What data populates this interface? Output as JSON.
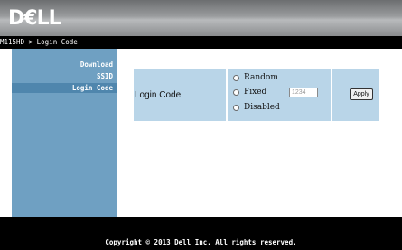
{
  "header": {
    "logo_text": "D€LL"
  },
  "breadcrumb": "M115HD > Login Code",
  "sidebar": {
    "items": [
      {
        "label": "Download",
        "active": false
      },
      {
        "label": "SSID",
        "active": false
      },
      {
        "label": "Login Code",
        "active": true
      }
    ]
  },
  "login_code": {
    "label": "Login Code",
    "options": [
      {
        "label": "Random",
        "selected": false
      },
      {
        "label": "Fixed",
        "selected": false
      },
      {
        "label": "Disabled",
        "selected": false
      }
    ],
    "fixed_value": "1234",
    "apply_label": "Apply"
  },
  "footer": {
    "copyright": "Copyright © 2013 Dell Inc. All rights reserved."
  }
}
